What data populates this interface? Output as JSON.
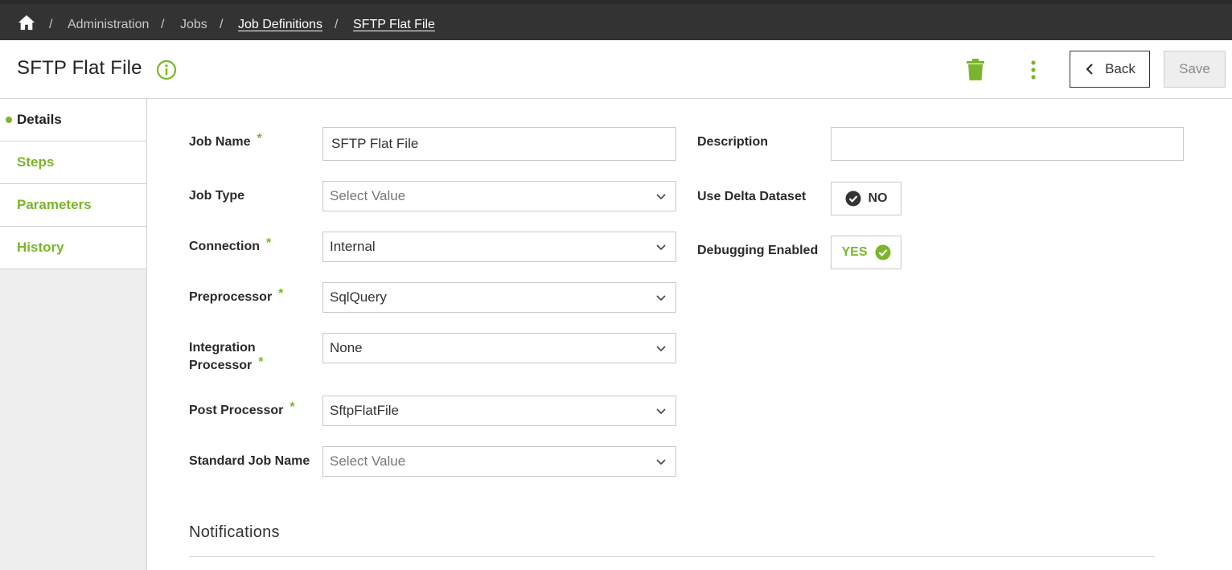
{
  "breadcrumb": {
    "items": [
      {
        "label": "Administration"
      },
      {
        "label": "Jobs"
      },
      {
        "label": "Job Definitions"
      },
      {
        "label": "SFTP Flat File"
      }
    ],
    "separator": "/"
  },
  "header": {
    "title": "SFTP Flat File",
    "back_label": "Back",
    "save_label": "Save"
  },
  "sidebar": {
    "items": [
      {
        "label": "Details",
        "active": true
      },
      {
        "label": "Steps"
      },
      {
        "label": "Parameters"
      },
      {
        "label": "History"
      }
    ]
  },
  "form": {
    "job_name": {
      "label": "Job Name",
      "value": "SFTP Flat File",
      "required": true
    },
    "job_type": {
      "label": "Job Type",
      "placeholder": "Select Value"
    },
    "connection": {
      "label": "Connection",
      "value": "Internal",
      "required": true
    },
    "preprocessor": {
      "label": "Preprocessor",
      "value": "SqlQuery",
      "required": true
    },
    "integration_processor": {
      "label_line1": "Integration",
      "label_line2": "Processor",
      "value": "None",
      "required": true
    },
    "post_processor": {
      "label": "Post Processor",
      "value": "SftpFlatFile",
      "required": true
    },
    "standard_job_name": {
      "label": "Standard Job Name",
      "placeholder": "Select Value"
    },
    "description": {
      "label": "Description",
      "value": ""
    },
    "use_delta_dataset": {
      "label": "Use Delta Dataset",
      "value": "NO"
    },
    "debugging_enabled": {
      "label": "Debugging Enabled",
      "value": "YES"
    },
    "required_marker": "*"
  },
  "notifications": {
    "title": "Notifications"
  },
  "colors": {
    "accent": "#7ab52b",
    "topbar": "#333333",
    "sidebar_bg": "#eeeeee"
  }
}
